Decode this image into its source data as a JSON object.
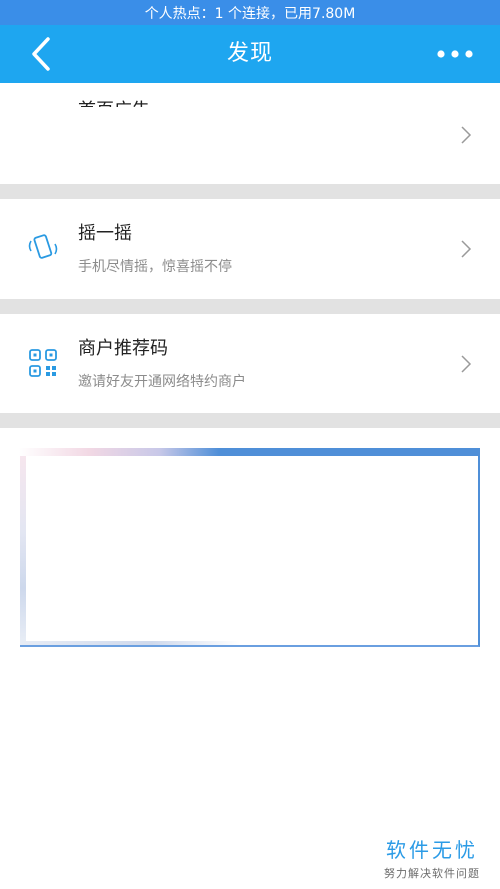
{
  "status_bar": {
    "text": "个人热点：1 个连接，已用7.80M"
  },
  "header": {
    "title": "发现",
    "back_icon": "chevron-left-icon",
    "more_icon": "more-dots-icon"
  },
  "list": [
    {
      "title": "首页广告",
      "subtitle": "",
      "icon": "none"
    },
    {
      "title": "摇一摇",
      "subtitle": "手机尽情摇，惊喜摇不停",
      "icon": "phone-shake-icon"
    },
    {
      "title": "商户推荐码",
      "subtitle": "邀请好友开通网络特约商户",
      "icon": "qr-code-icon"
    }
  ],
  "colors": {
    "status_bar": "#3a8ee8",
    "header": "#1ea6f0",
    "accent": "#1ea6f0",
    "divider": "#e2e2e2"
  },
  "watermark": {
    "main": "软件无忧",
    "sub": "努力解决软件问题"
  }
}
